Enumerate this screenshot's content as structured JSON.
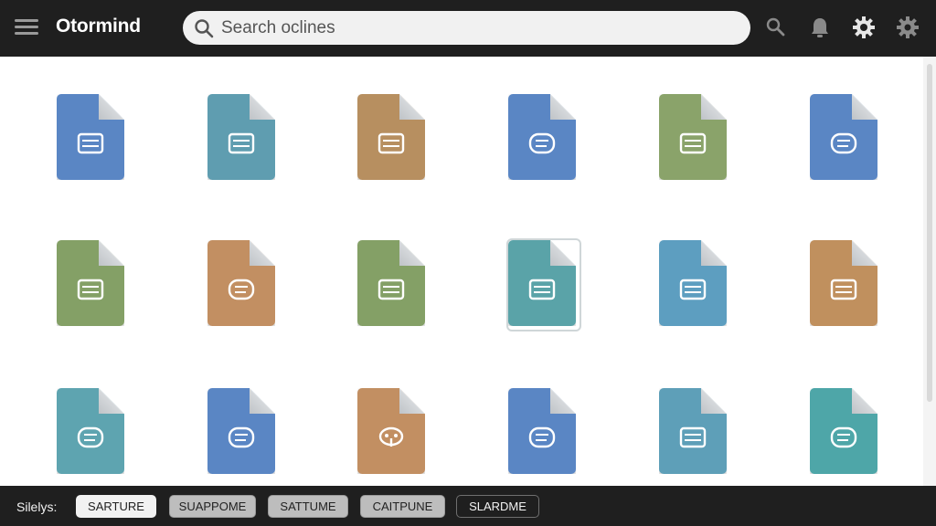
{
  "app": {
    "title": "Otormind"
  },
  "search": {
    "placeholder": "Search oclines",
    "value": ""
  },
  "top_icons": [
    "search-icon",
    "bell-icon",
    "gear-icon",
    "settings-icon"
  ],
  "files": [
    {
      "color": "#5a86c4",
      "glyph": "lines"
    },
    {
      "color": "#5f9db0",
      "glyph": "lines"
    },
    {
      "color": "#b78f60",
      "glyph": "lines"
    },
    {
      "color": "#5a86c4",
      "glyph": "bubble"
    },
    {
      "color": "#8aa36a",
      "glyph": "lines"
    },
    {
      "color": "#5a86c4",
      "glyph": "bubble"
    },
    {
      "color": "#84a066",
      "glyph": "lines"
    },
    {
      "color": "#c28f62",
      "glyph": "bubble"
    },
    {
      "color": "#84a066",
      "glyph": "lines"
    },
    {
      "color": "#5aa3a8",
      "glyph": "lines",
      "selected": true
    },
    {
      "color": "#5d9ec0",
      "glyph": "lines"
    },
    {
      "color": "#c0905e",
      "glyph": "lines"
    },
    {
      "color": "#5ea4b0",
      "glyph": "bubble"
    },
    {
      "color": "#5a86c4",
      "glyph": "bubble"
    },
    {
      "color": "#c28f62",
      "glyph": "face"
    },
    {
      "color": "#5a86c4",
      "glyph": "bubble"
    },
    {
      "color": "#5e9fb8",
      "glyph": "lines"
    },
    {
      "color": "#4ea6a8",
      "glyph": "bubble"
    }
  ],
  "bottom": {
    "label": "Silelys:",
    "chips": [
      {
        "label": "SARTURE",
        "style": "light"
      },
      {
        "label": "SUAPPOME",
        "style": "gray"
      },
      {
        "label": "SATTUME",
        "style": "gray"
      },
      {
        "label": "CAITPUNE",
        "style": "gray"
      },
      {
        "label": "SLARDME",
        "style": "dark"
      }
    ]
  }
}
